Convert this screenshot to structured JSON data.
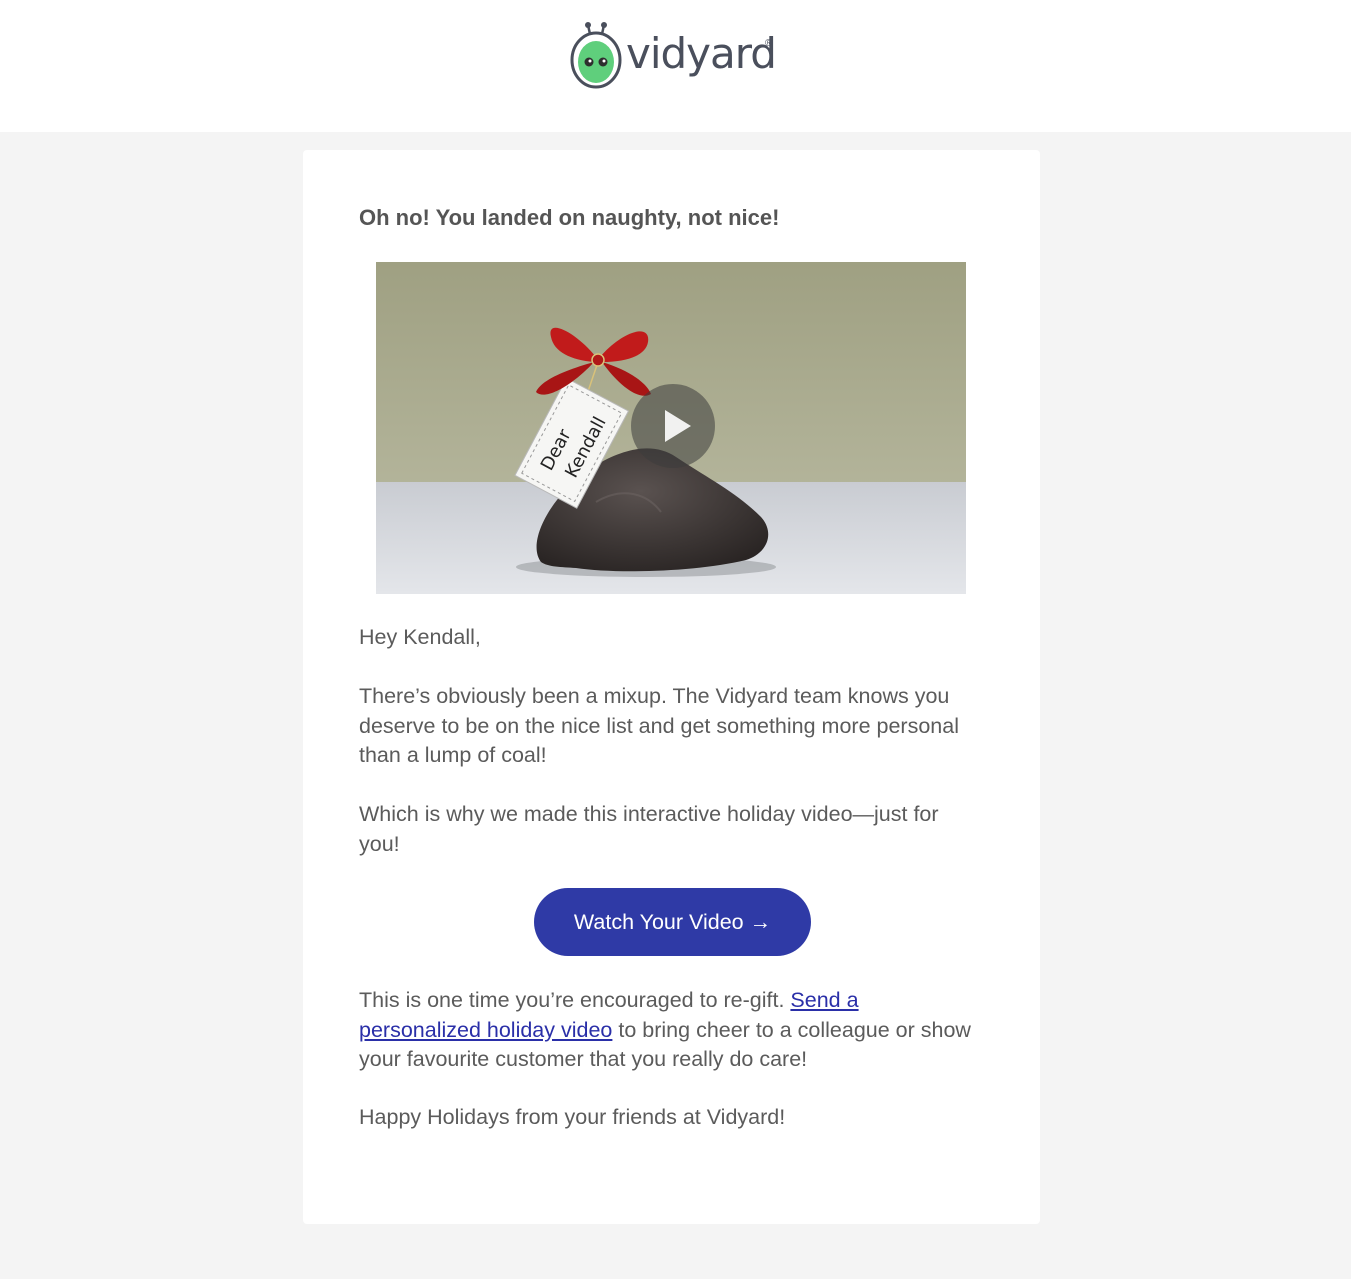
{
  "brand": {
    "name": "vidyard",
    "registered_mark": "®",
    "logo_icon": "vidyard-robot-icon",
    "accent_color": "#2f3aa6",
    "logo_green": "#5fcf7c"
  },
  "email": {
    "headline": "Oh no! You landed on naughty, not nice!",
    "video": {
      "thumbnail_icon": "coal-lump-with-bow",
      "tag_line1": "Dear",
      "tag_line2": "Kendall",
      "play_icon": "play-icon"
    },
    "greeting": "Hey Kendall,",
    "paragraph1": "There’s obviously been a mixup. The Vidyard team knows you deserve to be on the nice list and get something more personal than a lump of coal!",
    "paragraph2": "Which is why we made this interactive holiday video—just for you!",
    "cta_label": "Watch Your Video →",
    "paragraph3_before": "This is one time you’re encouraged to re-gift. ",
    "paragraph3_link": "Send a personalized holiday video",
    "paragraph3_after": " to bring cheer to a colleague or show your favourite customer that you really do care!",
    "signoff": "Happy Holidays from your friends at Vidyard!"
  }
}
